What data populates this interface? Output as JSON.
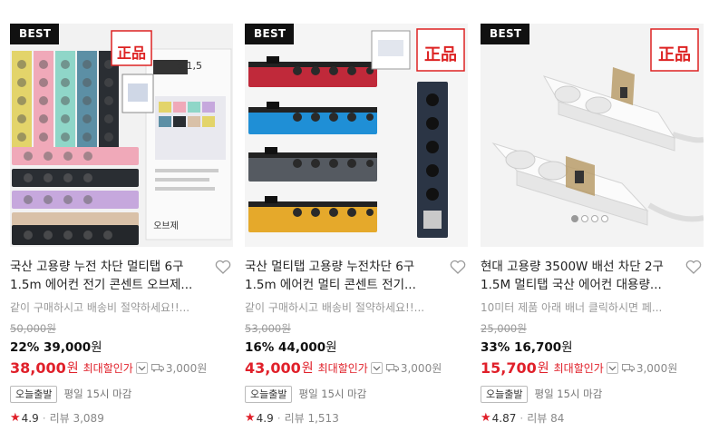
{
  "products": [
    {
      "badge": "BEST",
      "title": "국산 고용량 누전 차단 멀티탭 6구 1.5m 에어컨 전기 콘센트 오브제...",
      "subtitle": "같이 구매하시고 배송비 절약하세요!!...",
      "original_price": "50,000원",
      "discount_rate": "22%",
      "discount_price": "39,000",
      "discount_won": "원",
      "final_price": "38,000",
      "final_won": "원",
      "max_discount_label": "최대할인가",
      "shipping": "3,000원",
      "delivery_chip": "오늘출발",
      "delivery_time": "평일 15시 마감",
      "rating": "4.9",
      "review_label": "리뷰 3,089",
      "image_label_1": "오브제",
      "image_label_2": "6  1,5",
      "seal_text": "正品"
    },
    {
      "badge": "BEST",
      "title": "국산 멀티탭 고용량 누전차단 6구 1.5m 에어컨 멀티 콘센트 전기...",
      "subtitle": "같이 구매하시고 배송비 절약하세요!!...",
      "original_price": "53,000원",
      "discount_rate": "16%",
      "discount_price": "44,000",
      "discount_won": "원",
      "final_price": "43,000",
      "final_won": "원",
      "max_discount_label": "최대할인가",
      "shipping": "3,000원",
      "delivery_chip": "오늘출발",
      "delivery_time": "평일 15시 마감",
      "rating": "4.9",
      "review_label": "리뷰 1,513",
      "seal_text": "正品"
    },
    {
      "badge": "BEST",
      "title": "현대 고용량 3500W 배선 차단 2구 1.5M 멀티탭 국산 에어컨 대용량...",
      "subtitle": "10미터 제품 아래 배너 클릭하시면 페...",
      "original_price": "25,000원",
      "discount_rate": "33%",
      "discount_price": "16,700",
      "discount_won": "원",
      "final_price": "15,700",
      "final_won": "원",
      "max_discount_label": "최대할인가",
      "shipping": "3,000원",
      "delivery_chip": "오늘출발",
      "delivery_time": "평일 15시 마감",
      "rating": "4.87",
      "review_label": "리뷰 84",
      "seal_text": "正品"
    }
  ],
  "colors": {
    "accent_red": "#e0202a",
    "badge_bg": "#111111"
  }
}
